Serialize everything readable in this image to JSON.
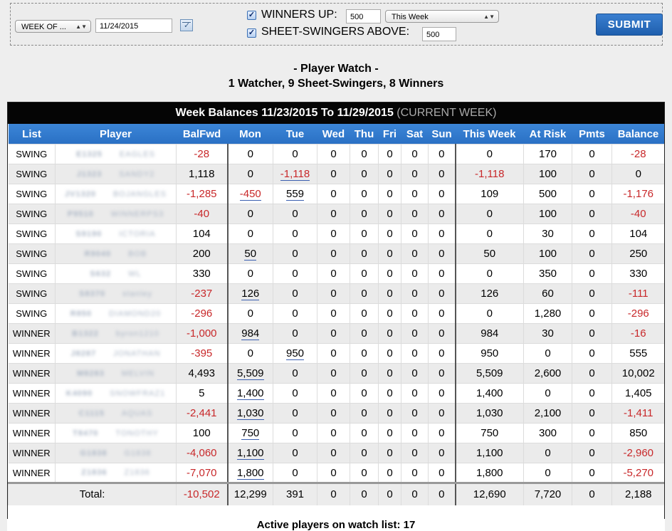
{
  "filter": {
    "period_select": "WEEK OF ...",
    "date_value": "11/24/2015",
    "winners_up_label": "WINNERS UP:",
    "winners_up_value": "500",
    "winners_period": "This Week",
    "sheet_swingers_label": "SHEET-SWINGERS ABOVE:",
    "sheet_swingers_value": "500",
    "submit_label": "SUBMIT"
  },
  "heading": {
    "title": "- Player Watch -",
    "subtitle": "1 Watcher, 9 Sheet-Swingers, 8 Winners"
  },
  "table": {
    "caption": "Week Balances 11/23/2015 To 11/29/2015",
    "caption_note": "(CURRENT WEEK)",
    "columns": [
      "List",
      "Player",
      "BalFwd",
      "Mon",
      "Tue",
      "Wed",
      "Thu",
      "Fri",
      "Sat",
      "Sun",
      "This Week",
      "At Risk",
      "Pmts",
      "Balance"
    ],
    "rows": [
      {
        "list": "SWING",
        "id": "E1325",
        "name": "EAGLES",
        "balfwd": "-28",
        "mon": "0",
        "tue": "0",
        "wed": "0",
        "thu": "0",
        "fri": "0",
        "sat": "0",
        "sun": "0",
        "week": "0",
        "risk": "170",
        "pmts": "0",
        "balance": "-28"
      },
      {
        "list": "SWING",
        "id": "J1323",
        "name": "SANDY2",
        "balfwd": "1,118",
        "mon": "0",
        "tue": "-1,118",
        "wed": "0",
        "thu": "0",
        "fri": "0",
        "sat": "0",
        "sun": "0",
        "week": "-1,118",
        "risk": "100",
        "pmts": "0",
        "balance": "0"
      },
      {
        "list": "SWING",
        "id": "JV1320",
        "name": "BOJANGLES",
        "balfwd": "-1,285",
        "mon": "-450",
        "tue": "559",
        "wed": "0",
        "thu": "0",
        "fri": "0",
        "sat": "0",
        "sun": "0",
        "week": "109",
        "risk": "500",
        "pmts": "0",
        "balance": "-1,176"
      },
      {
        "list": "SWING",
        "id": "P9510",
        "name": "WINNERPS3",
        "balfwd": "-40",
        "mon": "0",
        "tue": "0",
        "wed": "0",
        "thu": "0",
        "fri": "0",
        "sat": "0",
        "sun": "0",
        "week": "0",
        "risk": "100",
        "pmts": "0",
        "balance": "-40"
      },
      {
        "list": "SWING",
        "id": "S9190",
        "name": "ICTORIA",
        "balfwd": "104",
        "mon": "0",
        "tue": "0",
        "wed": "0",
        "thu": "0",
        "fri": "0",
        "sat": "0",
        "sun": "0",
        "week": "0",
        "risk": "30",
        "pmts": "0",
        "balance": "104"
      },
      {
        "list": "SWING",
        "id": "R9040",
        "name": "BOB",
        "balfwd": "200",
        "mon": "50",
        "tue": "0",
        "wed": "0",
        "thu": "0",
        "fri": "0",
        "sat": "0",
        "sun": "0",
        "week": "50",
        "risk": "100",
        "pmts": "0",
        "balance": "250"
      },
      {
        "list": "SWING",
        "id": "S632",
        "name": "WL",
        "balfwd": "330",
        "mon": "0",
        "tue": "0",
        "wed": "0",
        "thu": "0",
        "fri": "0",
        "sat": "0",
        "sun": "0",
        "week": "0",
        "risk": "350",
        "pmts": "0",
        "balance": "330"
      },
      {
        "list": "SWING",
        "id": "S8370",
        "name": "stanley",
        "balfwd": "-237",
        "mon": "126",
        "tue": "0",
        "wed": "0",
        "thu": "0",
        "fri": "0",
        "sat": "0",
        "sun": "0",
        "week": "126",
        "risk": "60",
        "pmts": "0",
        "balance": "-111"
      },
      {
        "list": "SWING",
        "id": "R850",
        "name": "DIAMOND20",
        "balfwd": "-296",
        "mon": "0",
        "tue": "0",
        "wed": "0",
        "thu": "0",
        "fri": "0",
        "sat": "0",
        "sun": "0",
        "week": "0",
        "risk": "1,280",
        "pmts": "0",
        "balance": "-296"
      },
      {
        "list": "WINNER",
        "id": "B1322",
        "name": "byron1210",
        "balfwd": "-1,000",
        "mon": "984",
        "tue": "0",
        "wed": "0",
        "thu": "0",
        "fri": "0",
        "sat": "0",
        "sun": "0",
        "week": "984",
        "risk": "30",
        "pmts": "0",
        "balance": "-16"
      },
      {
        "list": "WINNER",
        "id": "J8287",
        "name": "JONATHAN",
        "balfwd": "-395",
        "mon": "0",
        "tue": "950",
        "wed": "0",
        "thu": "0",
        "fri": "0",
        "sat": "0",
        "sun": "0",
        "week": "950",
        "risk": "0",
        "pmts": "0",
        "balance": "555"
      },
      {
        "list": "WINNER",
        "id": "M8283",
        "name": "MELVIN",
        "balfwd": "4,493",
        "mon": "5,509",
        "tue": "0",
        "wed": "0",
        "thu": "0",
        "fri": "0",
        "sat": "0",
        "sun": "0",
        "week": "5,509",
        "risk": "2,600",
        "pmts": "0",
        "balance": "10,002"
      },
      {
        "list": "WINNER",
        "id": "K4090",
        "name": "SNOWFRAZ1",
        "balfwd": "5",
        "mon": "1,400",
        "tue": "0",
        "wed": "0",
        "thu": "0",
        "fri": "0",
        "sat": "0",
        "sun": "0",
        "week": "1,400",
        "risk": "0",
        "pmts": "0",
        "balance": "1,405"
      },
      {
        "list": "WINNER",
        "id": "C1115",
        "name": "AQUAS",
        "balfwd": "-2,441",
        "mon": "1,030",
        "tue": "0",
        "wed": "0",
        "thu": "0",
        "fri": "0",
        "sat": "0",
        "sun": "0",
        "week": "1,030",
        "risk": "2,100",
        "pmts": "0",
        "balance": "-1,411"
      },
      {
        "list": "WINNER",
        "id": "T8470",
        "name": "TONOTHY",
        "balfwd": "100",
        "mon": "750",
        "tue": "0",
        "wed": "0",
        "thu": "0",
        "fri": "0",
        "sat": "0",
        "sun": "0",
        "week": "750",
        "risk": "300",
        "pmts": "0",
        "balance": "850"
      },
      {
        "list": "WINNER",
        "id": "G1838",
        "name": "G1838",
        "balfwd": "-4,060",
        "mon": "1,100",
        "tue": "0",
        "wed": "0",
        "thu": "0",
        "fri": "0",
        "sat": "0",
        "sun": "0",
        "week": "1,100",
        "risk": "0",
        "pmts": "0",
        "balance": "-2,960"
      },
      {
        "list": "WINNER",
        "id": "Z1836",
        "name": "Z1836",
        "balfwd": "-7,070",
        "mon": "1,800",
        "tue": "0",
        "wed": "0",
        "thu": "0",
        "fri": "0",
        "sat": "0",
        "sun": "0",
        "week": "1,800",
        "risk": "0",
        "pmts": "0",
        "balance": "-5,270"
      }
    ],
    "total": {
      "label": "Total:",
      "balfwd": "-10,502",
      "mon": "12,299",
      "tue": "391",
      "wed": "0",
      "thu": "0",
      "fri": "0",
      "sat": "0",
      "sun": "0",
      "week": "12,690",
      "risk": "7,720",
      "pmts": "0",
      "balance": "2,188"
    }
  },
  "footer": "Active players on watch list: 17",
  "colors": {
    "negative": "#c8282a",
    "header_blue": "#2f78cc",
    "caption_bg": "#050505"
  }
}
